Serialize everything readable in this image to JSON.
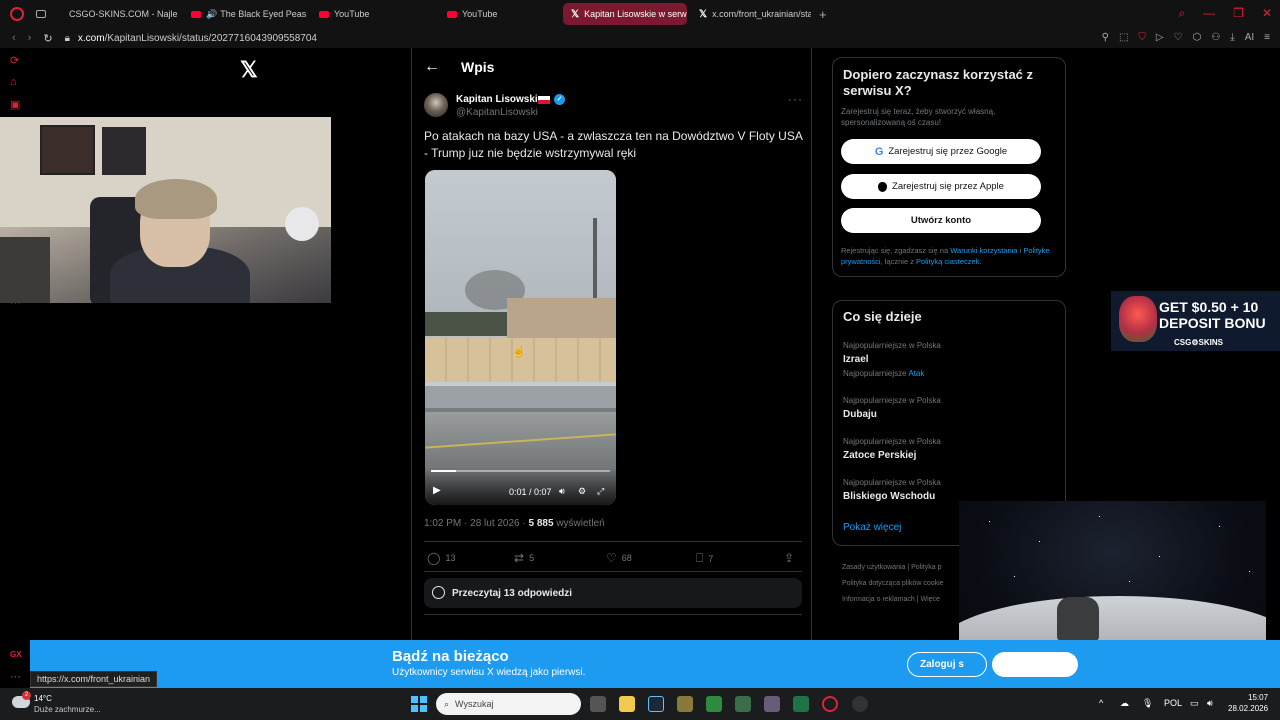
{
  "browser": {
    "tabs": [
      {
        "label": "CSGO-SKINS.COM - Najle",
        "icon": "csgo-icon"
      },
      {
        "label": "The Black Eyed Peas",
        "icon": "youtube-icon",
        "audio": true
      },
      {
        "label": "YouTube",
        "icon": "youtube-icon"
      },
      {
        "label": "YouTube",
        "icon": "youtube-icon"
      },
      {
        "label": "Kapitan Lisowskiе w serw",
        "icon": "x-icon",
        "active": true
      },
      {
        "label": "x.com/front_ukrainian/stat",
        "icon": "x-icon"
      }
    ],
    "url_domain": "x.com",
    "url_path": "/KapitanLisowski/status/2027716043909558704",
    "ext_ai_label": "AI",
    "sidebar_label": "GX",
    "status_url": "https://x.com/front_ukrainian"
  },
  "post": {
    "page_title": "Wpis",
    "author_name": "Kapitan Lisowski",
    "author_handle": "@KapitanLisowski",
    "text": "Po atakach na bazy USA - a zwlaszcza ten na Dowództwo V Floty USA - Trump juz nie będzie wstrzymywal ręki",
    "video": {
      "time": "0:01 / 0:07",
      "progress": 0.14
    },
    "timestamp": "1:02 PM · 28 lut 2026 · ",
    "views": "5 885",
    "views_label": " wyświetleń",
    "replies": "13",
    "reposts": "5",
    "likes": "68",
    "bookmarks": "7",
    "read_replies": "Przeczytaj 13 odpowiedzi"
  },
  "signup": {
    "title": "Dopiero zaczynasz korzystać z serwisu X?",
    "subtitle": "Zarejestruj się teraz, żeby stworzyć własną, spersonalizowaną oś czasu!",
    "google_btn": "Zarejestruj się przez Google",
    "apple_btn": "Zarejestruj się przez Apple",
    "create_btn": "Utwórz konto",
    "legal_1": "Rejestrując się, zgadzasz się na ",
    "legal_terms": "Warunki korzystania",
    "legal_2": " i ",
    "legal_privacy": "Polityke prywatności",
    "legal_3": ", łącznie z ",
    "legal_cookies": "Polityką ciasteczek",
    "legal_4": "."
  },
  "trends": {
    "title": "Co się dzieje",
    "items": [
      {
        "meta": "Najpopularniejsze w Polska",
        "name": "Izrael",
        "sub_prefix": "Najpopularniejsze ",
        "sub_link": "Atak"
      },
      {
        "meta": "Najpopularniejsze w Polska",
        "name": "Dubaju"
      },
      {
        "meta": "Najpopularniejsze w Polska",
        "name": "Zatoce Perskiej"
      },
      {
        "meta": "Najpopularniejsze w Polska",
        "name": "Bliskiego Wschodu"
      }
    ],
    "show_more": "Pokaż więcej"
  },
  "footer": {
    "links_1": "Zasady użytkowania  |  Polityka p",
    "links_2": "Polityka dotycząca plików cookie",
    "links_3": "Informacja o reklamach  |  Więce"
  },
  "ad": {
    "line1": "GET $0.50 + 10",
    "line2": "DEPOSIT BONU",
    "brand": "CSG⚙SKINS"
  },
  "login_bar": {
    "title": "Bądź na bieżąco",
    "subtitle": "Użytkownicy serwisu X wiedzą jako pierwsi.",
    "login_btn": "Zaloguj s"
  },
  "taskbar": {
    "weather_badge": "2",
    "temperature": "14°C",
    "condition": "Duże zachmurze...",
    "search_placeholder": "Wyszukaj",
    "language": "POL",
    "time": "15:07",
    "date": "28.02.2026"
  },
  "colors": {
    "accent": "#1d9bf0",
    "opera_red": "#e0213a",
    "tab_active": "#7a1930"
  }
}
